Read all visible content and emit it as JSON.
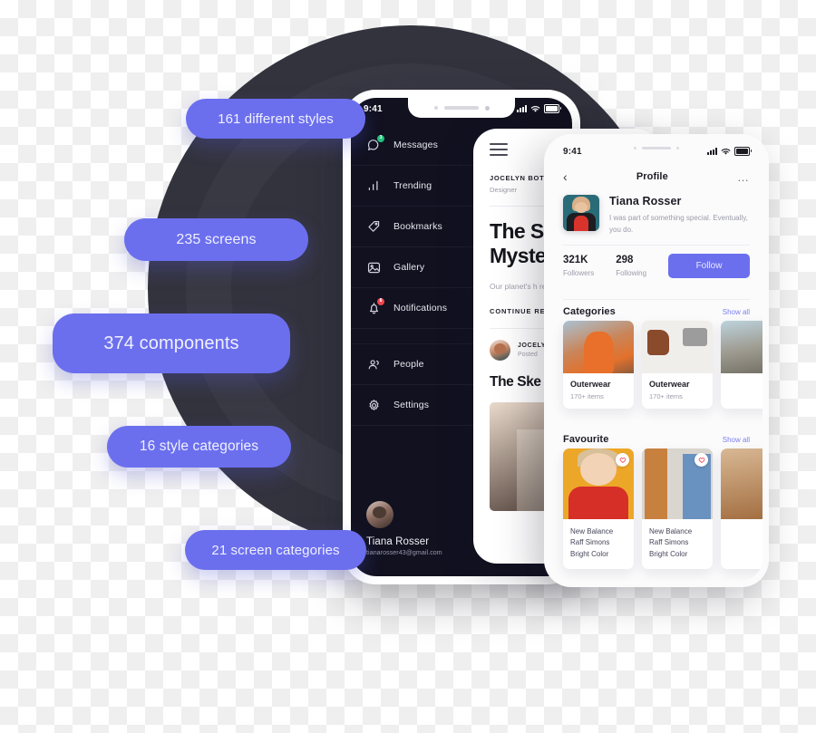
{
  "background": {
    "kind": "transparency-checkerboard",
    "circle_color": "#33333e",
    "circle_ring_color": "#393944",
    "accent_color": "#6b6fee"
  },
  "pills": [
    {
      "id": "styles",
      "label": "161 different styles"
    },
    {
      "id": "screens",
      "label": "235 screens"
    },
    {
      "id": "components",
      "label": "374 components"
    },
    {
      "id": "style-categories",
      "label": "16 style categories"
    },
    {
      "id": "screen-categories",
      "label": "21 screen categories"
    }
  ],
  "phone_dark": {
    "status": {
      "time": "9:41",
      "signal_icon": "signal-bars-icon",
      "wifi_icon": "wifi-icon",
      "battery_icon": "battery-icon"
    },
    "menu": [
      {
        "label": "Messages",
        "icon": "chat-bubble-icon",
        "badge": "3",
        "badge_color": "#21c37a"
      },
      {
        "label": "Trending",
        "icon": "bar-chart-icon",
        "badge": "",
        "badge_color": ""
      },
      {
        "label": "Bookmarks",
        "icon": "tag-icon",
        "badge": "",
        "badge_color": ""
      },
      {
        "label": "Gallery",
        "icon": "image-icon",
        "badge": "",
        "badge_color": ""
      },
      {
        "label": "Notifications",
        "icon": "bell-icon",
        "badge": "8",
        "badge_color": "#f0444f"
      },
      {
        "label": "People",
        "icon": "people-icon",
        "badge": "",
        "badge_color": ""
      },
      {
        "label": "Settings",
        "icon": "gear-icon",
        "badge": "",
        "badge_color": ""
      }
    ],
    "account": {
      "name": "Tiana Rosser",
      "email": "tianarosser43@gmail.com"
    }
  },
  "phone_article": {
    "menu_icon": "hamburger-icon",
    "author": "JOCELYN BOTOSH",
    "role": "Designer",
    "title": "The Sky Olmost Myster",
    "body": "Our planet's h result of a coll a Mercury.",
    "continue_label": "CONTINUE READ",
    "byline": {
      "name": "JOCELYN",
      "meta": "Posted"
    },
    "title2": "The Ske Uncove"
  },
  "phone_profile": {
    "status": {
      "time": "9:41",
      "signal_icon": "signal-bars-icon",
      "wifi_icon": "wifi-icon",
      "battery_icon": "battery-icon"
    },
    "nav": {
      "back_icon": "chevron-left-icon",
      "title": "Profile",
      "more_icon": "more-horizontal-icon"
    },
    "user": {
      "name": "Tiana Rosser",
      "bio": "I was part of something special. Eventually, you do."
    },
    "stats": {
      "followers_value": "321K",
      "followers_label": "Followers",
      "following_value": "298",
      "following_label": "Following",
      "follow_button": "Follow"
    },
    "categories": {
      "title": "Categories",
      "show_all": "Show all",
      "cards": [
        {
          "name": "Outerwear",
          "items": "170+ items"
        },
        {
          "name": "Outerwear",
          "items": "170+ items"
        },
        {
          "name": "",
          "items": ""
        }
      ]
    },
    "favourite": {
      "title": "Favourite",
      "show_all": "Show all",
      "cards": [
        {
          "name": "New Balance Raff Simons Bright Color",
          "heart_icon": "heart-icon"
        },
        {
          "name": "New Balance Raff Simons Bright Color",
          "heart_icon": "heart-icon"
        },
        {
          "name": "",
          "heart_icon": "heart-icon"
        }
      ]
    }
  }
}
